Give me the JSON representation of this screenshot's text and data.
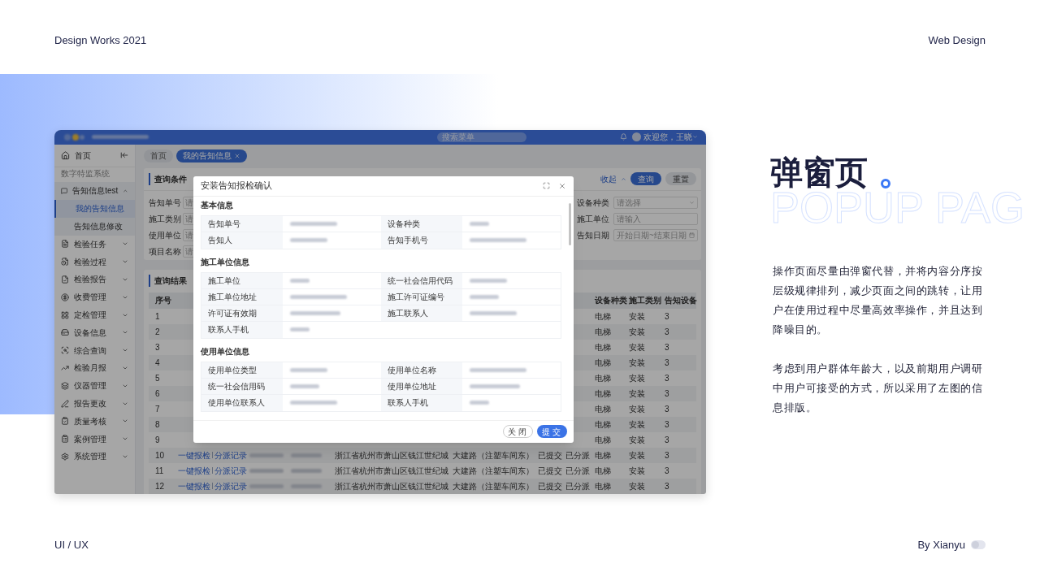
{
  "slide": {
    "top_left": "Design Works 2021",
    "top_right": "Web Design",
    "bottom_left": "UI / UX",
    "bottom_right": "By Xianyu"
  },
  "app": {
    "header": {
      "search_placeholder": "搜索菜单",
      "user": "欢迎您，王晓"
    },
    "sidebar": {
      "home": "首页",
      "section": "数字特监系统",
      "items": [
        {
          "label": "告知信息test",
          "expanded": true,
          "selected": false,
          "children": [
            {
              "label": "我的告知信息",
              "selected": true
            },
            {
              "label": "告知信息修改",
              "selected": false
            }
          ]
        },
        {
          "label": "检验任务",
          "expanded": false,
          "selected": false
        },
        {
          "label": "检验过程",
          "expanded": false,
          "selected": false
        },
        {
          "label": "检验报告",
          "expanded": false,
          "selected": false
        },
        {
          "label": "收费管理",
          "expanded": false,
          "selected": false
        },
        {
          "label": "定检管理",
          "expanded": false,
          "selected": false
        },
        {
          "label": "设备信息",
          "expanded": false,
          "selected": false
        },
        {
          "label": "综合查询",
          "expanded": false,
          "selected": false
        },
        {
          "label": "检验月报",
          "expanded": false,
          "selected": false
        },
        {
          "label": "仪器管理",
          "expanded": false,
          "selected": false
        },
        {
          "label": "报告更改",
          "expanded": false,
          "selected": false
        },
        {
          "label": "质量考核",
          "expanded": false,
          "selected": false
        },
        {
          "label": "案例管理",
          "expanded": false,
          "selected": false
        },
        {
          "label": "系统管理",
          "expanded": false,
          "selected": false
        }
      ]
    },
    "tabs": [
      {
        "label": "首页",
        "selected": false,
        "closable": false
      },
      {
        "label": "我的告知信息",
        "selected": true,
        "closable": true
      }
    ],
    "query": {
      "title": "查询条件",
      "collapse": "收起",
      "search_button": "查询",
      "reset_button": "重置",
      "left_fields": [
        {
          "label": "告知单号",
          "placeholder": "请"
        },
        {
          "label": "施工类别",
          "placeholder": "请"
        },
        {
          "label": "使用单位",
          "placeholder": "请"
        },
        {
          "label": "项目名称",
          "placeholder": "请"
        }
      ],
      "right_fields": [
        {
          "label": "设备种类",
          "placeholder": "请选择",
          "kind": "select"
        },
        {
          "label": "施工单位",
          "placeholder": "请输入",
          "kind": "input"
        },
        {
          "label": "告知日期",
          "placeholder": "开始日期~结束日期",
          "kind": "date"
        }
      ]
    },
    "results": {
      "title": "查询结果",
      "header": {
        "no": "序号",
        "device": "设备种类",
        "type": "施工类别",
        "count": "告知设备"
      },
      "rows": [
        {
          "no": "1",
          "device": "电梯",
          "type": "安装",
          "count": "3"
        },
        {
          "no": "2",
          "device": "电梯",
          "type": "安装",
          "count": "3"
        },
        {
          "no": "3",
          "device": "电梯",
          "type": "安装",
          "count": "3"
        },
        {
          "no": "4",
          "device": "电梯",
          "type": "安装",
          "count": "3"
        },
        {
          "no": "5",
          "device": "电梯",
          "type": "安装",
          "count": "3"
        },
        {
          "no": "6",
          "device": "电梯",
          "type": "安装",
          "count": "3"
        },
        {
          "no": "7",
          "device": "电梯",
          "type": "安装",
          "count": "3"
        },
        {
          "no": "8",
          "device": "电梯",
          "type": "安装",
          "count": "3"
        },
        {
          "no": "9",
          "device": "电梯",
          "type": "安装",
          "count": "3"
        },
        {
          "no": "10",
          "actions": [
            "一键报检",
            "分派记录"
          ],
          "blurred": true,
          "address": "浙江省杭州市萧山区钱江世纪城",
          "road": "大建路（注塑车间东）",
          "status": "已提交",
          "dispatch": "已分派",
          "device": "电梯",
          "type": "安装",
          "count": "3"
        },
        {
          "no": "11",
          "actions": [
            "一键报检",
            "分派记录"
          ],
          "blurred": true,
          "address": "浙江省杭州市萧山区钱江世纪城",
          "road": "大建路（注塑车间东）",
          "status": "已提交",
          "dispatch": "已分派",
          "device": "电梯",
          "type": "安装",
          "count": "3"
        },
        {
          "no": "12",
          "actions": [
            "一键报检",
            "分派记录"
          ],
          "blurred": true,
          "address": "浙江省杭州市萧山区钱江世纪城",
          "road": "大建路（注塑车间东）",
          "status": "已提交",
          "dispatch": "已分派",
          "device": "电梯",
          "type": "安装",
          "count": "3"
        }
      ]
    }
  },
  "modal": {
    "title": "安装告知报检确认",
    "sections": [
      {
        "title": "基本信息",
        "fields": [
          {
            "label": "告知单号",
            "blurred": true
          },
          {
            "label": "设备种类",
            "blurred": true
          },
          {
            "label": "告知人",
            "blurred": true
          },
          {
            "label": "告知手机号",
            "blurred": true
          }
        ]
      },
      {
        "title": "施工单位信息",
        "fields": [
          {
            "label": "施工单位",
            "blurred": true
          },
          {
            "label": "统一社会信用代码",
            "blurred": true
          },
          {
            "label": "施工单位地址",
            "blurred": true
          },
          {
            "label": "施工许可证编号",
            "blurred": true
          },
          {
            "label": "许可证有效期",
            "blurred": true
          },
          {
            "label": "施工联系人",
            "blurred": true
          },
          {
            "label": "联系人手机",
            "blurred": true
          }
        ]
      },
      {
        "title": "使用单位信息",
        "fields": [
          {
            "label": "使用单位类型",
            "blurred": true
          },
          {
            "label": "使用单位名称",
            "blurred": true
          },
          {
            "label": "统一社会信用码",
            "blurred": true
          },
          {
            "label": "使用单位地址",
            "blurred": true
          },
          {
            "label": "使用单位联系人",
            "blurred": true
          },
          {
            "label": "联系人手机",
            "blurred": true
          }
        ]
      }
    ],
    "buttons": [
      {
        "label": "关闭",
        "kind": "secondary"
      },
      {
        "label": "提交",
        "kind": "primary"
      }
    ]
  },
  "aside": {
    "title": "弹窗页",
    "subtitle": "POPUP PAG",
    "paragraphs": [
      "操作页面尽量由弹窗代替，并将内容分序按层级规律排列，减少页面之间的跳转，让用户在使用过程中尽量高效率操作，并且达到降噪目的。",
      "考虑到用户群体年龄大，以及前期用户调研中用户可接受的方式，所以采用了左图的信息排版。"
    ]
  }
}
